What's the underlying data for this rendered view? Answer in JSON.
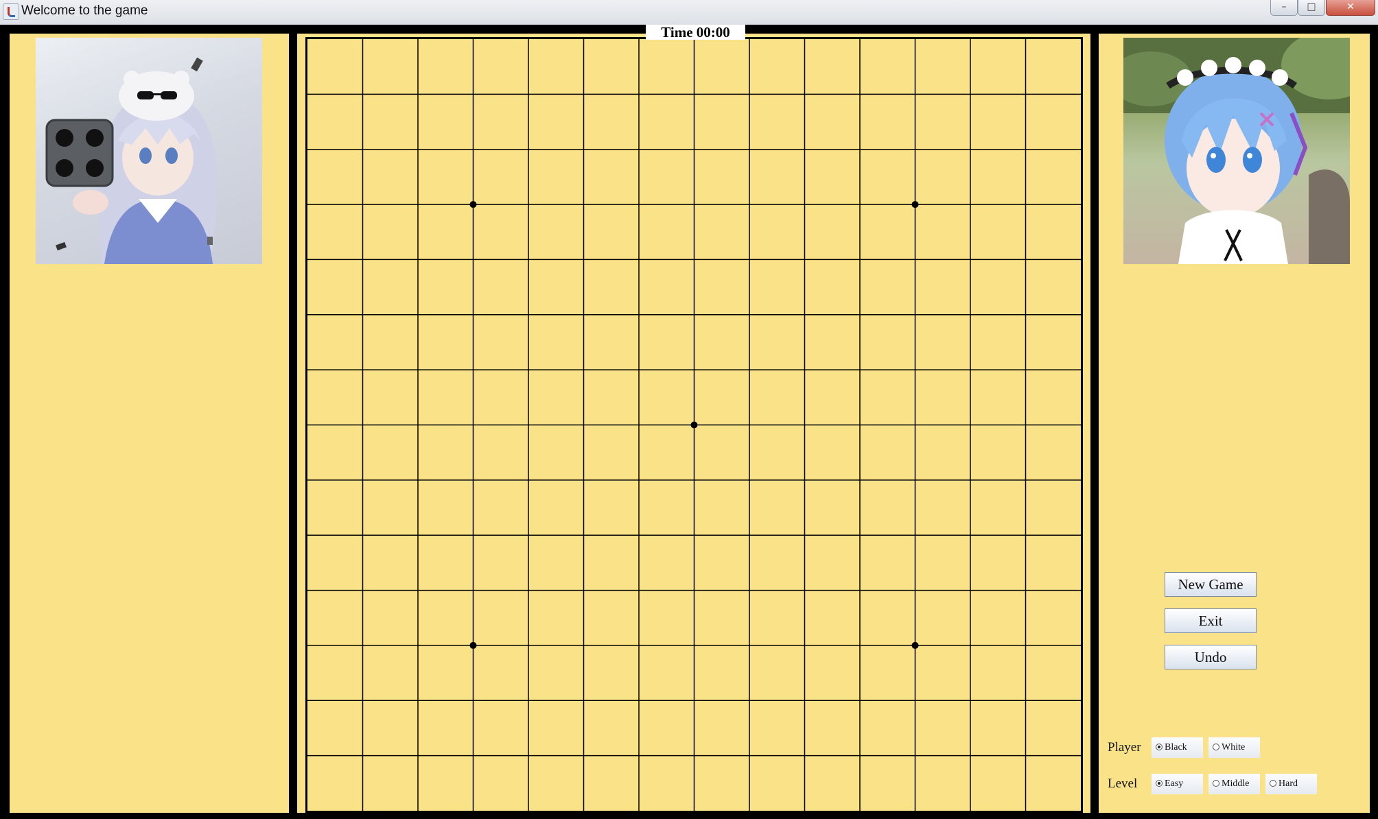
{
  "window": {
    "title": "Welcome to the game",
    "controls": {
      "minimize": "–",
      "maximize": "□",
      "close": "✕"
    }
  },
  "timer": {
    "label": "Time 00:00"
  },
  "board": {
    "lines": 15,
    "star_points": [
      [
        3,
        3
      ],
      [
        3,
        11
      ],
      [
        7,
        7
      ],
      [
        11,
        3
      ],
      [
        11,
        11
      ]
    ],
    "stones": []
  },
  "players": {
    "left_portrait": "player-portrait-left",
    "right_portrait": "player-portrait-right"
  },
  "buttons": {
    "new_game": "New Game",
    "exit": "Exit",
    "undo": "Undo"
  },
  "options": {
    "player_label": "Player",
    "player_choices": [
      "Black",
      "White"
    ],
    "player_selected": "Black",
    "level_label": "Level",
    "level_choices": [
      "Easy",
      "Middle",
      "Hard"
    ],
    "level_selected": "Easy"
  },
  "colors": {
    "board": "#fae288",
    "frame": "#000000",
    "grid": "#000000"
  }
}
